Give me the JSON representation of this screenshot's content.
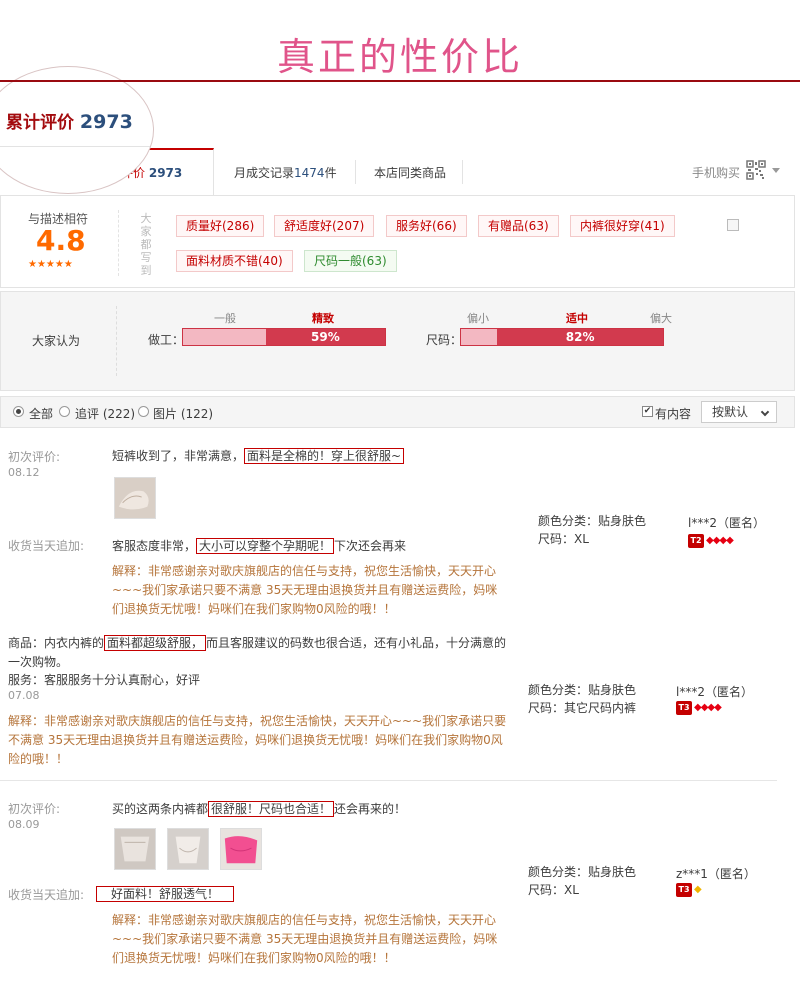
{
  "headline": "真正的性价比",
  "zoom": {
    "label": "累计评价",
    "count": "2973"
  },
  "tabs": {
    "active_label": "评价",
    "active_count": "2973",
    "monthly_label": "月成交记录",
    "monthly_count": "1474",
    "monthly_unit": "件",
    "similar": "本店同类商品",
    "phone": "手机购买"
  },
  "rating": {
    "desc_label": "与描述相符",
    "score": "4.8",
    "stars": "★★★★★",
    "tags_heading": "大家都写到"
  },
  "tags": [
    {
      "label": "质量好(286)",
      "kind": "bad"
    },
    {
      "label": "舒适度好(207)",
      "kind": "bad"
    },
    {
      "label": "服务好(66)",
      "kind": "bad"
    },
    {
      "label": "有赠品(63)",
      "kind": "bad"
    },
    {
      "label": "内裤很好穿(41)",
      "kind": "bad"
    },
    {
      "label": "面料材质不错(40)",
      "kind": "bad"
    },
    {
      "label": "尺码一般(63)",
      "kind": "good"
    }
  ],
  "consensus": {
    "label": "大家认为",
    "workmanship": {
      "label": "做工：",
      "low": "一般",
      "mid": "精致",
      "value_pct": 59,
      "pct_text": "59%"
    },
    "size": {
      "label": "尺码：",
      "low": "偏小",
      "mid": "适中",
      "high": "偏大",
      "value_pct": 82,
      "pct_text": "82%"
    }
  },
  "filters": {
    "all": "全部",
    "followup": "追评 (222)",
    "pictures": "图片 (122)",
    "has_content": "有内容",
    "sort": "按默认"
  },
  "reviews": {
    "r1": {
      "first_label": "初次评价:",
      "date": "08.12",
      "text_pre": "短裤收到了，非常满意，",
      "text_box": "面料是全棉的！穿上很舒服~",
      "follow_label": "收货当天追加:",
      "follow_pre": "客服态度非常，",
      "follow_box": "大小可以穿整个孕期呢！",
      "follow_post": "下次还会再来",
      "reply_1": "解释：非常感谢亲对歌庆旗舰店的信任与支持，祝您生活愉快，天天开心",
      "reply_2": "~~~我们家承诺只要不满意 35天无理由退换货并且有赠送运费险，妈咪",
      "reply_3": "们退换货无忧哦！妈咪们在我们家购物0风险的哦！！",
      "color": "颜色分类：贴身肤色",
      "size": "尺码：XL",
      "user": "l***2（匿名）",
      "level": "T2"
    },
    "r2": {
      "prod_pre": "商品：内衣内裤的",
      "prod_box": "面料都超级舒服，",
      "prod_post": "而且客服建议的码数也很合适，还有小礼品，十分满意的",
      "prod_2": "一次购物。",
      "service": "服务：客服服务十分认真耐心，好评",
      "date": "07.08",
      "reply_1": "解释：非常感谢亲对歌庆旗舰店的信任与支持，祝您生活愉快，天天开心~~~我们家承诺只要",
      "reply_2": "不满意 35天无理由退换货并且有赠送运费险，妈咪们退换货无忧哦！妈咪们在我们家购物0风",
      "reply_3": "险的哦！！",
      "color": "颜色分类：贴身肤色",
      "size": "尺码：其它尺码内裤",
      "user": "l***2（匿名）",
      "level": "T3"
    },
    "r3": {
      "first_label": "初次评价:",
      "date": "08.09",
      "text_pre": "买的这两条内裤都",
      "text_box": "很舒服！尺码也合适！",
      "text_post": "还会再来的！",
      "follow_label": "收货当天追加:",
      "follow_box": "好面料！舒服透气！",
      "reply_1": "解释：非常感谢亲对歌庆旗舰店的信任与支持，祝您生活愉快，天天开心",
      "reply_2": "~~~我们家承诺只要不满意 35天无理由退换货并且有赠送运费险，妈咪",
      "reply_3": "们退换货无忧哦！妈咪们在我们家购物0风险的哦！！",
      "color": "颜色分类：贴身肤色",
      "size": "尺码：XL",
      "user": "z***1（匿名）",
      "level": "T3"
    }
  }
}
